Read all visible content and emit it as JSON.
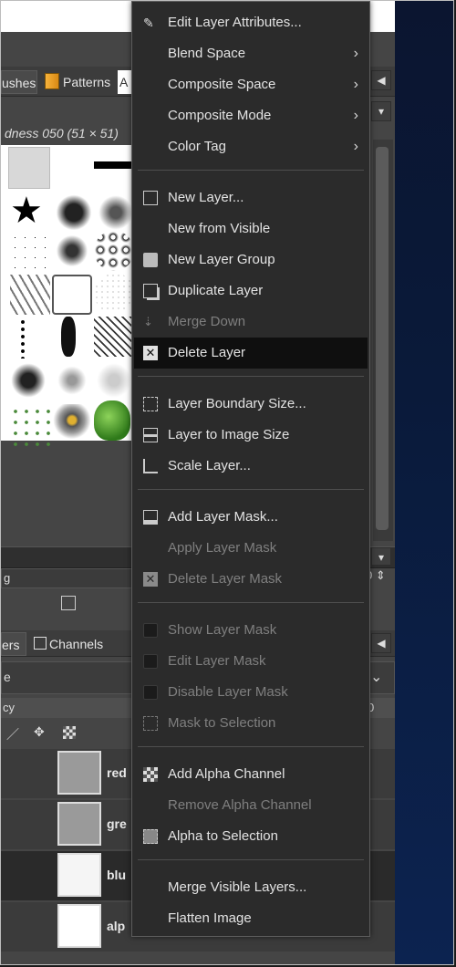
{
  "brushes_panel": {
    "tab_brushes": "ushes",
    "tab_patterns": "Patterns",
    "tab_partial": "A",
    "brush_name": "dness 050 (51 × 51)",
    "field_label": "g"
  },
  "layers_panel": {
    "tab_layers": "ers",
    "tab_channels": "Channels",
    "mode_label": "e",
    "opacity_label": "cy",
    "opacity_value": "0",
    "field_value": "0",
    "layers": [
      {
        "name": "red"
      },
      {
        "name": "gre"
      },
      {
        "name": "blu"
      },
      {
        "name": "alp"
      }
    ]
  },
  "context_menu": {
    "items": [
      {
        "label": "Edit Layer Attributes...",
        "icon": "edit-attributes-icon",
        "enabled": true
      },
      {
        "label": "Blend Space",
        "submenu": true,
        "enabled": true
      },
      {
        "label": "Composite Space",
        "submenu": true,
        "enabled": true
      },
      {
        "label": "Composite Mode",
        "submenu": true,
        "enabled": true
      },
      {
        "label": "Color Tag",
        "submenu": true,
        "enabled": true
      },
      {
        "label": "New Layer...",
        "icon": "new-layer-icon",
        "enabled": true
      },
      {
        "label": "New from Visible",
        "enabled": true
      },
      {
        "label": "New Layer Group",
        "icon": "new-group-icon",
        "enabled": true
      },
      {
        "label": "Duplicate Layer",
        "icon": "duplicate-icon",
        "enabled": true
      },
      {
        "label": "Merge Down",
        "icon": "merge-down-icon",
        "enabled": false
      },
      {
        "label": "Delete Layer",
        "icon": "delete-icon",
        "enabled": true,
        "highlighted": true
      },
      {
        "label": "Layer Boundary Size...",
        "icon": "boundary-size-icon",
        "enabled": true
      },
      {
        "label": "Layer to Image Size",
        "icon": "layer-to-image-icon",
        "enabled": true
      },
      {
        "label": "Scale Layer...",
        "icon": "scale-layer-icon",
        "enabled": true
      },
      {
        "label": "Add Layer Mask...",
        "icon": "add-mask-icon",
        "enabled": true
      },
      {
        "label": "Apply Layer Mask",
        "enabled": false
      },
      {
        "label": "Delete Layer Mask",
        "icon": "delete-mask-icon",
        "enabled": false
      },
      {
        "label": "Show Layer Mask",
        "checkbox": true,
        "enabled": false
      },
      {
        "label": "Edit Layer Mask",
        "checkbox": true,
        "enabled": false
      },
      {
        "label": "Disable Layer Mask",
        "checkbox": true,
        "enabled": false
      },
      {
        "label": "Mask to Selection",
        "icon": "mask-to-selection-icon",
        "enabled": false
      },
      {
        "label": "Add Alpha Channel",
        "icon": "add-alpha-icon",
        "enabled": true
      },
      {
        "label": "Remove Alpha Channel",
        "enabled": false
      },
      {
        "label": "Alpha to Selection",
        "icon": "alpha-to-selection-icon",
        "enabled": true
      },
      {
        "label": "Merge Visible Layers...",
        "enabled": true
      },
      {
        "label": "Flatten Image",
        "enabled": true
      }
    ],
    "submenu_glyph": "›"
  },
  "colors": {
    "menu_bg": "#2b2b2b",
    "highlight_bg": "#0f0f0f",
    "text": "#e3e3e3",
    "disabled_text": "#7f7f7f"
  }
}
